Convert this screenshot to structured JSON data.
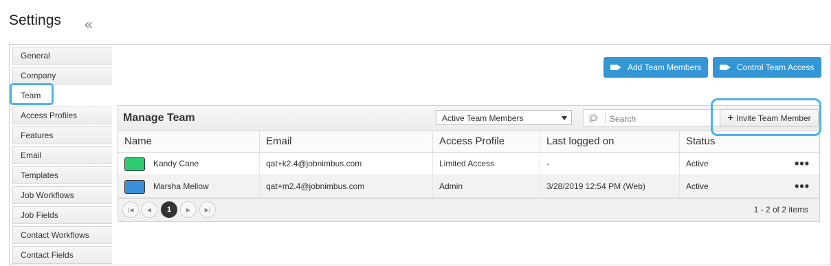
{
  "page": {
    "title": "Settings"
  },
  "sidebar": {
    "items": [
      {
        "label": "General"
      },
      {
        "label": "Company"
      },
      {
        "label": "Team"
      },
      {
        "label": "Access Profiles"
      },
      {
        "label": "Features"
      },
      {
        "label": "Email"
      },
      {
        "label": "Templates"
      },
      {
        "label": "Job Workflows"
      },
      {
        "label": "Job Fields"
      },
      {
        "label": "Contact Workflows"
      },
      {
        "label": "Contact Fields"
      }
    ],
    "active_index": 2
  },
  "toolbar": {
    "add_team_members": "Add Team Members",
    "control_team_access": "Control Team Access",
    "icon": "video-camera-icon",
    "accent": "#3596d6"
  },
  "panel": {
    "title": "Manage Team",
    "filter": {
      "selected": "Active Team Members"
    },
    "search": {
      "placeholder": "Search",
      "value": ""
    },
    "invite_label": "Invite Team Member"
  },
  "table": {
    "columns": [
      "Name",
      "Email",
      "Access Profile",
      "Last logged on",
      "Status"
    ],
    "rows": [
      {
        "color": "#2ecc71",
        "name": "Kandy Cane",
        "email": "qat+k2.4@jobnimbus.com",
        "profile": "Limited Access",
        "last": "-",
        "status": "Active"
      },
      {
        "color": "#3a8fdc",
        "name": "Marsha Mellow",
        "email": "qat+m2.4@jobnimbus.com",
        "profile": "Admin",
        "last": "3/28/2019 12:54 PM (Web)",
        "status": "Active"
      }
    ]
  },
  "pager": {
    "current_page": "1",
    "info": "1 - 2 of 2 items"
  },
  "highlight_color": "#4ab3e8"
}
